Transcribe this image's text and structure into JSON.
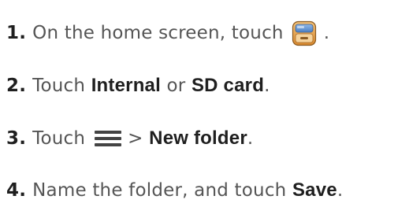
{
  "steps": [
    {
      "number": "1.",
      "text_before": "On the home screen, touch",
      "icon": "file-manager-icon",
      "text_after": "."
    },
    {
      "number": "2.",
      "text_before": "Touch",
      "bold_1": "Internal",
      "middle": "or",
      "bold_2": "SD card",
      "text_after": "."
    },
    {
      "number": "3.",
      "text_before": "Touch",
      "icon": "menu-icon",
      "separator": ">",
      "bold_1": "New folder",
      "text_after": "."
    },
    {
      "number": "4.",
      "text_before": "Name the folder, and touch",
      "bold_1": "Save",
      "text_after": "."
    }
  ],
  "colors": {
    "text": "#555555",
    "number_and_bold": "#1f1f1f",
    "icon_accent": "#e8a64a",
    "menu_icon": "#444444"
  }
}
